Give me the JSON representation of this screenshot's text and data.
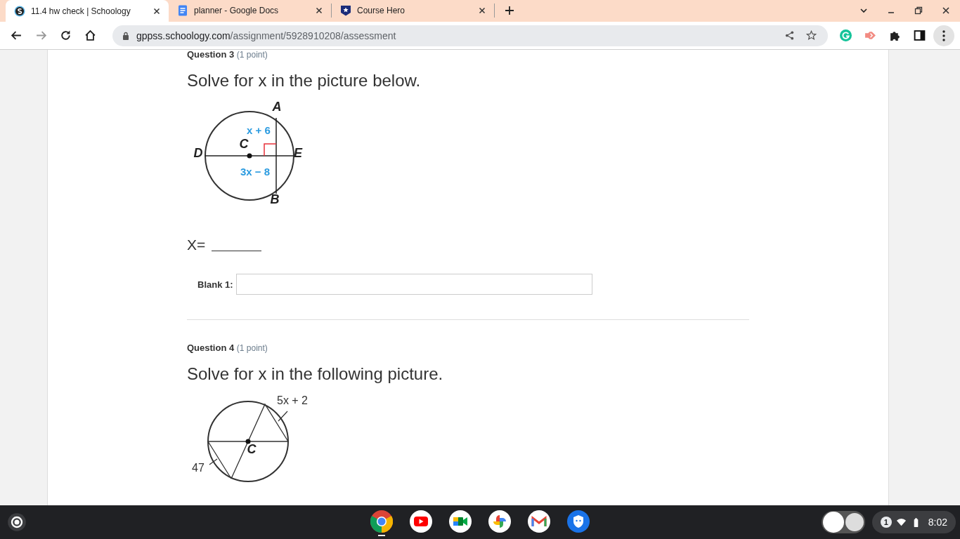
{
  "browser": {
    "tabs": [
      {
        "title": "11.4 hw check | Schoology",
        "selected": true
      },
      {
        "title": "planner - Google Docs",
        "selected": false
      },
      {
        "title": "Course Hero",
        "selected": false
      }
    ],
    "url": {
      "host": "gppss.schoology.com",
      "path": "/assignment/5928910208/assessment"
    }
  },
  "questions": [
    {
      "number": "Question 3",
      "points": "(1 point)",
      "prompt": "Solve for x in the picture below.",
      "figure": {
        "kind": "perpendicular-chord",
        "labels": [
          {
            "text": "A",
            "kind": "point"
          },
          {
            "text": "x + 6",
            "kind": "expression"
          },
          {
            "text": "C",
            "kind": "point"
          },
          {
            "text": "D",
            "kind": "point"
          },
          {
            "text": "E",
            "kind": "point"
          },
          {
            "text": "3x − 8",
            "kind": "expression"
          },
          {
            "text": "B",
            "kind": "point"
          }
        ]
      },
      "answer_prefix": "X=",
      "blank_label": "Blank 1:"
    },
    {
      "number": "Question 4",
      "points": "(1 point)",
      "prompt": "Solve for x in the following picture.",
      "figure": {
        "kind": "parallel-chords",
        "labels": [
          {
            "text": "5x + 2",
            "kind": "measure"
          },
          {
            "text": "C",
            "kind": "point"
          },
          {
            "text": "47",
            "kind": "measure"
          }
        ]
      }
    }
  ],
  "shelf": {
    "apps": [
      {
        "running": true
      },
      {
        "running": false
      },
      {
        "running": false
      },
      {
        "running": false
      },
      {
        "running": false
      },
      {
        "running": false
      }
    ],
    "notification_count": "1",
    "time": "8:02"
  }
}
